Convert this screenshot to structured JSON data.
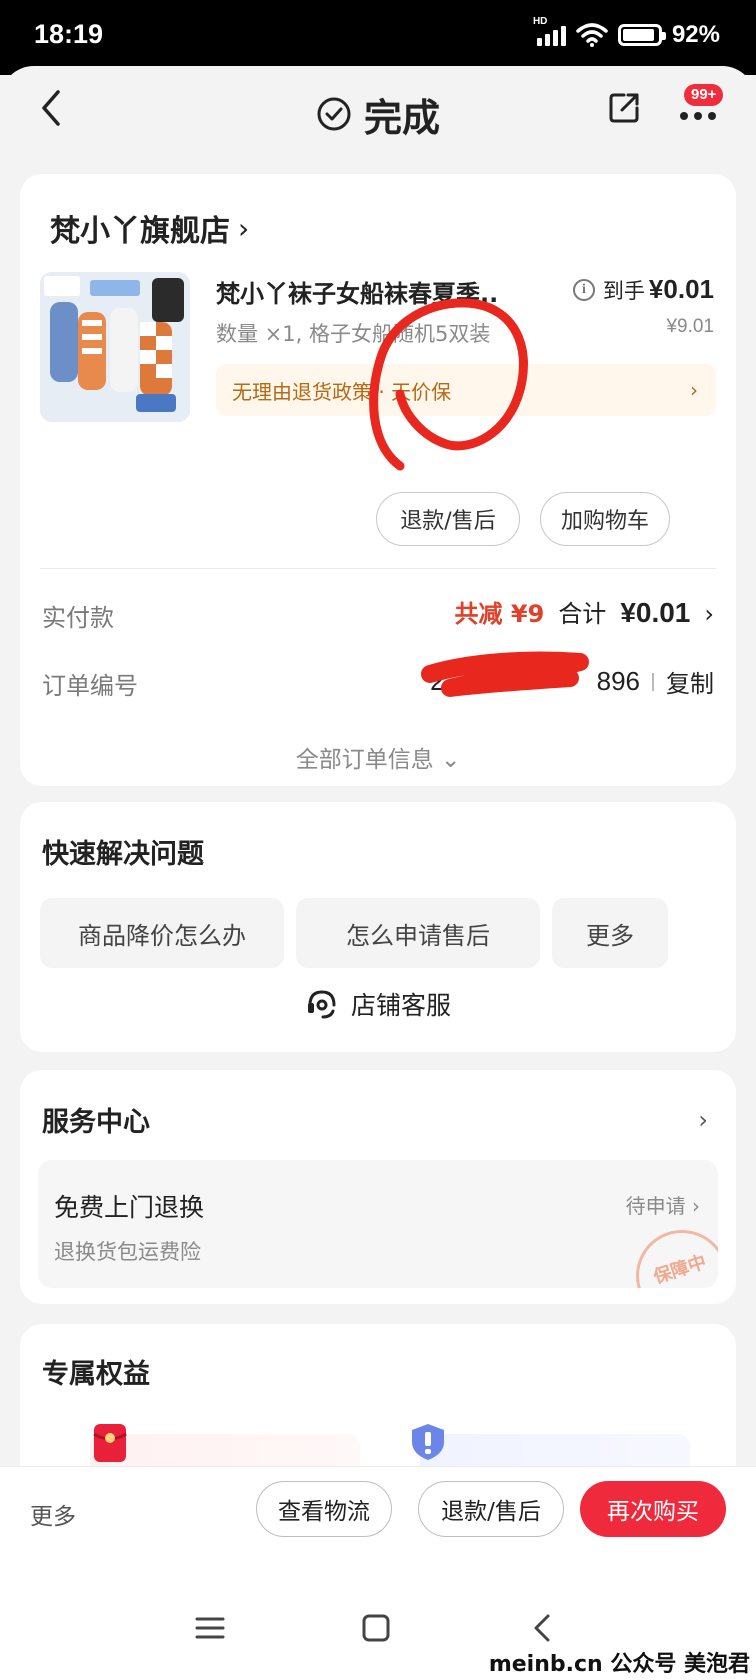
{
  "status_bar": {
    "time": "18:19",
    "network": "HD",
    "battery": "92%"
  },
  "header": {
    "title": "完成",
    "notification_badge": "99+"
  },
  "order": {
    "store_name": "梵小丫旗舰店",
    "product": {
      "title": "梵小丫袜子女船袜春夏季..",
      "spec": "数量 ×1, 格子女船随机5双装",
      "final_price_label": "到手",
      "final_price": "¥0.01",
      "original_price": "¥9.01",
      "policy": "无理由退货政策 · 天价保"
    },
    "buttons": {
      "refund": "退款/售后",
      "add_cart": "加购物车"
    },
    "payment": {
      "label": "实付款",
      "discount": "共减 ¥9",
      "total_label": "合计",
      "total_value": "¥0.01"
    },
    "order_number": {
      "label": "订单编号",
      "value_start": "2",
      "value_end": "896",
      "copy": "复制"
    },
    "all_info": "全部订单信息"
  },
  "quick_solve": {
    "title": "快速解决问题",
    "chips": [
      "商品降价怎么办",
      "怎么申请售后",
      "更多"
    ],
    "service_link": "店铺客服"
  },
  "service_center": {
    "title": "服务中心",
    "item_name": "免费上门退换",
    "item_desc": "退换货包运费险",
    "item_status": "待申请",
    "stamp": "保障中"
  },
  "benefits": {
    "title": "专属权益"
  },
  "bottom_bar": {
    "more": "更多",
    "logistics": "查看物流",
    "refund": "退款/售后",
    "buy_again": "再次购买"
  },
  "watermark": "meinb.cn  公众号 美泡君",
  "colors": {
    "primary_red": "#ef2a3d",
    "discount_red": "#e0412a",
    "policy_text": "#b56a14",
    "annotation_red": "#e8281e"
  }
}
